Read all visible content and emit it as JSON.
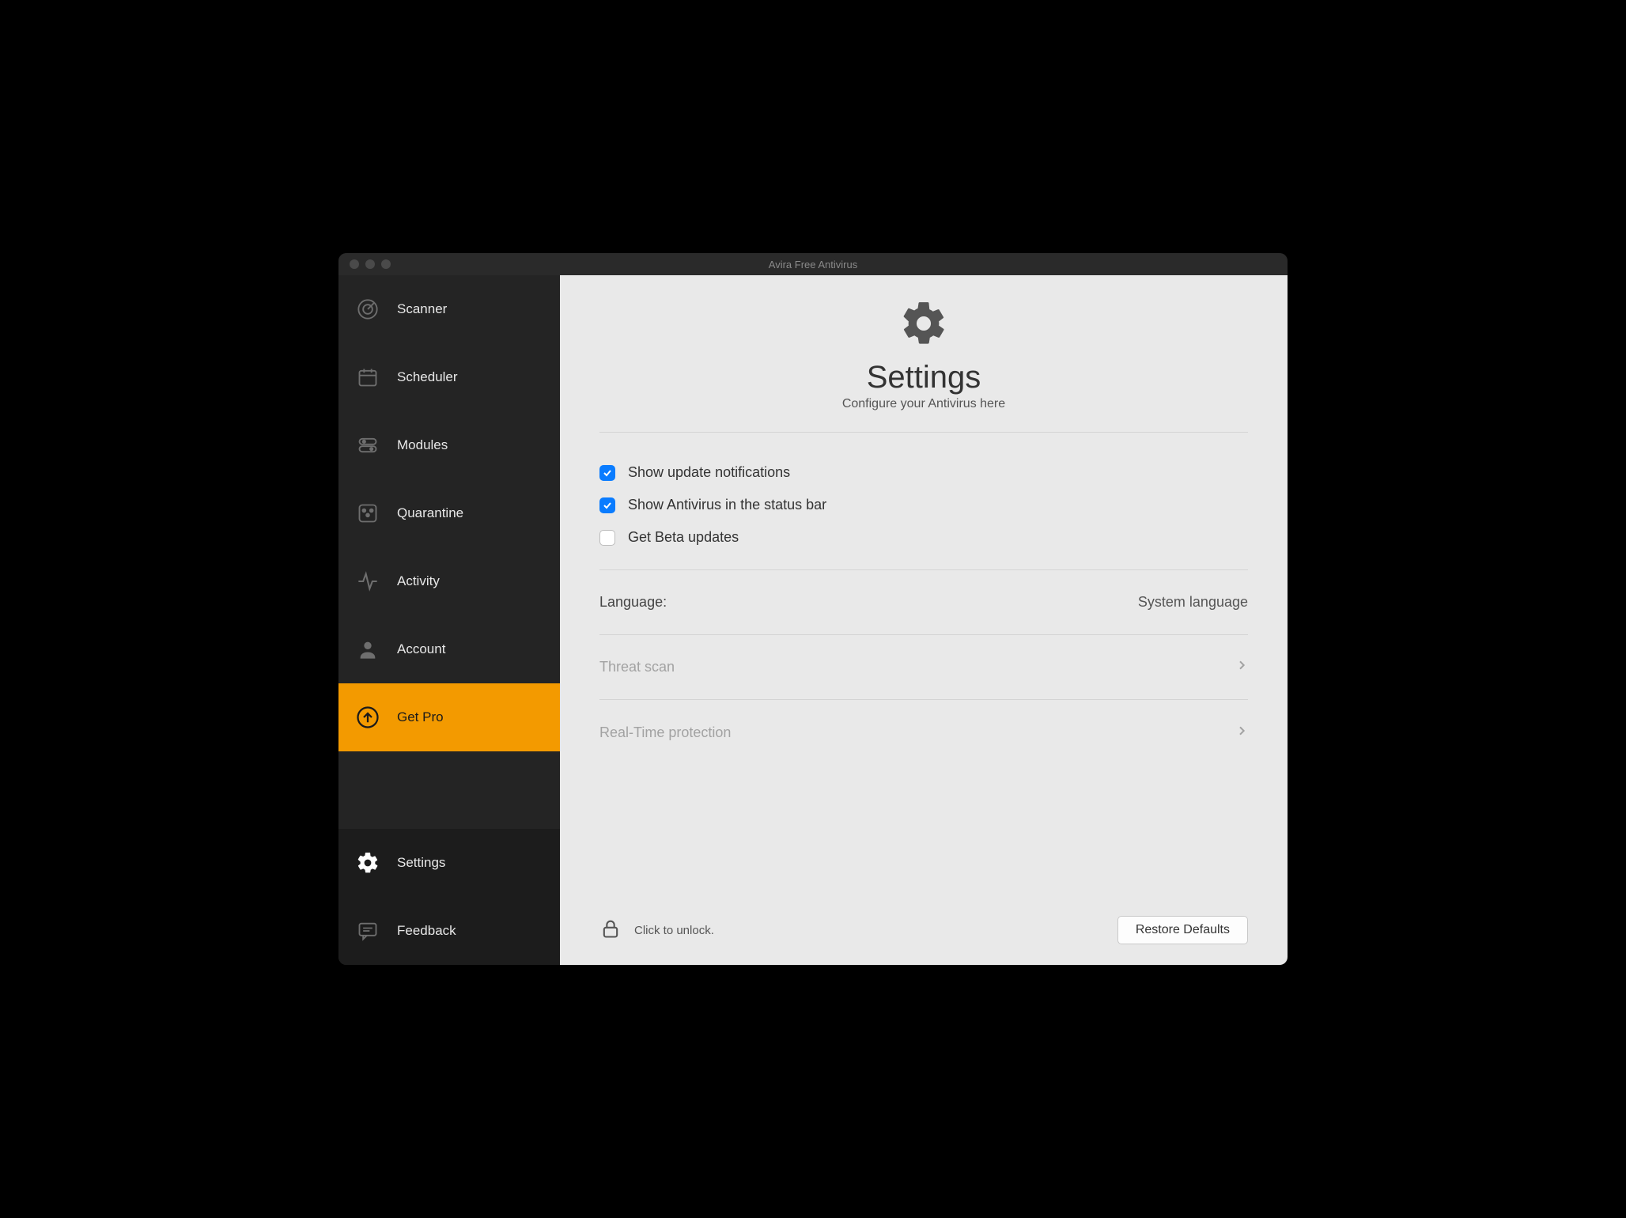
{
  "window": {
    "title": "Avira Free Antivirus"
  },
  "sidebar": {
    "items": [
      {
        "id": "scanner",
        "label": "Scanner",
        "icon": "radar-icon"
      },
      {
        "id": "scheduler",
        "label": "Scheduler",
        "icon": "calendar-icon"
      },
      {
        "id": "modules",
        "label": "Modules",
        "icon": "toggles-icon"
      },
      {
        "id": "quarantine",
        "label": "Quarantine",
        "icon": "dice-icon"
      },
      {
        "id": "activity",
        "label": "Activity",
        "icon": "pulse-icon"
      },
      {
        "id": "account",
        "label": "Account",
        "icon": "person-icon"
      },
      {
        "id": "getpro",
        "label": "Get Pro",
        "icon": "upgrade-icon",
        "highlight": true
      }
    ],
    "bottom": [
      {
        "id": "settings",
        "label": "Settings",
        "icon": "gear-icon",
        "active": true
      },
      {
        "id": "feedback",
        "label": "Feedback",
        "icon": "chat-icon"
      }
    ]
  },
  "main": {
    "title": "Settings",
    "subtitle": "Configure your Antivirus here",
    "checkboxes": [
      {
        "id": "update_notifications",
        "label": "Show update notifications",
        "checked": true
      },
      {
        "id": "status_bar",
        "label": "Show Antivirus in the status bar",
        "checked": true
      },
      {
        "id": "beta_updates",
        "label": "Get Beta updates",
        "checked": false
      }
    ],
    "language_row": {
      "label": "Language:",
      "value": "System language"
    },
    "nav_rows": [
      {
        "id": "threat_scan",
        "label": "Threat scan",
        "disabled": true
      },
      {
        "id": "rtp",
        "label": "Real-Time protection",
        "disabled": true
      }
    ],
    "lock_hint": "Click to unlock.",
    "restore_label": "Restore Defaults"
  },
  "colors": {
    "accent": "#f39a00",
    "checkbox_blue": "#0a7cff"
  }
}
